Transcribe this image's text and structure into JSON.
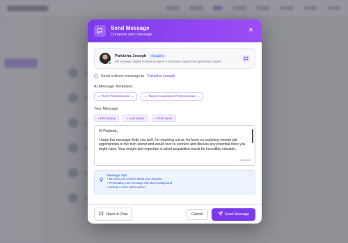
{
  "modal": {
    "title": "Send Message",
    "subtitle": "Compose your message",
    "close_icon": "close-icon"
  },
  "recipient": {
    "name": "Palvisha Joseph",
    "badge": "Recipient",
    "description": "HR manager digital marketing expert e-commerc expert lead generation expert",
    "online": true
  },
  "direct": {
    "prefix": "Send a direct message to",
    "name": "Palvisha Joseph"
  },
  "templates": {
    "label": "AI Message Templates",
    "items": [
      "Tech Professionals",
      "Talent Acquisition Professionals"
    ]
  },
  "message": {
    "label": "Your Message",
    "placeholders": [
      "+ First Name",
      "+ Last Name",
      "+ Full Name"
    ],
    "greeting": "Hi Palvisha,",
    "body": "I hope this message finds you well. I'm reaching out as I'm keen on exploring remote job opportunities in the tech sector and would love to connect and discuss any potential roles you might have. Your insight and expertise in talent acquisition would be incredibly valuable.",
    "counter": "280/2000"
  },
  "tips": {
    "title": "Message Tips",
    "items": [
      "Be clear and concise about your purpose",
      "Personalize your message with their background",
      "Include a clear call-to-action"
    ]
  },
  "footer": {
    "open_chat": "Open in Chat",
    "cancel": "Cancel",
    "send": "Send Message"
  },
  "colors": {
    "accent": "#7c3aed",
    "online": "#22c55e",
    "tips_bg": "#eef4ff"
  }
}
